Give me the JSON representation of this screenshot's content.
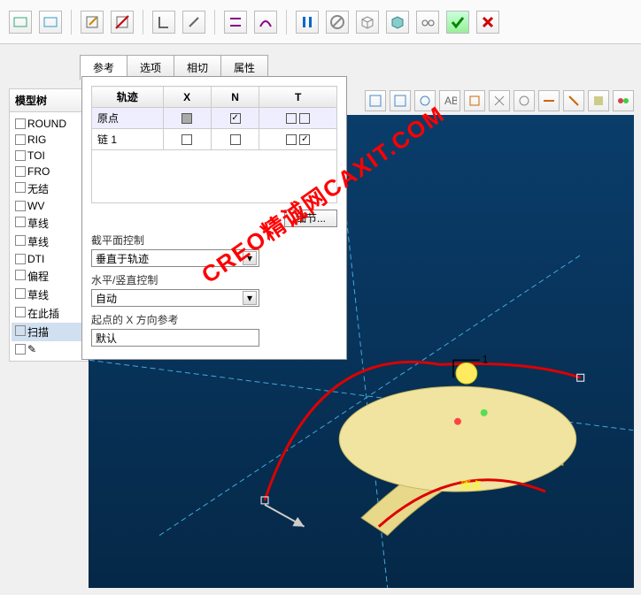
{
  "toolbar": {
    "icons": [
      "rect",
      "rect2",
      "edit",
      "slash-rect",
      "bracket",
      "slash",
      "line1",
      "curve",
      "pause",
      "forbid",
      "cube1",
      "cube2",
      "glasses",
      "check",
      "close"
    ]
  },
  "tabs": [
    {
      "label": "参考",
      "active": true
    },
    {
      "label": "选项",
      "active": false
    },
    {
      "label": "相切",
      "active": false
    },
    {
      "label": "属性",
      "active": false
    }
  ],
  "model_tree": {
    "header": "模型树",
    "items": [
      "ROUND",
      "RIG",
      "TOI",
      "FRO",
      "无结",
      "WV",
      "草线",
      "草线",
      "DTI",
      "偏程",
      "草线",
      "在此插",
      "扫描",
      "✎"
    ]
  },
  "traj": {
    "headers": [
      "轨迹",
      "X",
      "N",
      "T"
    ],
    "rows": [
      {
        "name": "原点",
        "x": "gray",
        "n": "check",
        "t": [
          "",
          ""
        ]
      },
      {
        "name": "链 1",
        "x": "",
        "n": "",
        "t": [
          "",
          "check"
        ]
      }
    ],
    "details_btn": "细节..."
  },
  "controls": {
    "section_label": "截平面控制",
    "section_value": "垂直于轨迹",
    "hv_label": "水平/竖直控制",
    "hv_value": "自动",
    "xref_label": "起点的 X 方向参考",
    "xref_value": "默认"
  },
  "viewport": {
    "origin_label": "原点",
    "handle_label": "1"
  },
  "watermark": "CREO精诚网CAXIT.COM"
}
